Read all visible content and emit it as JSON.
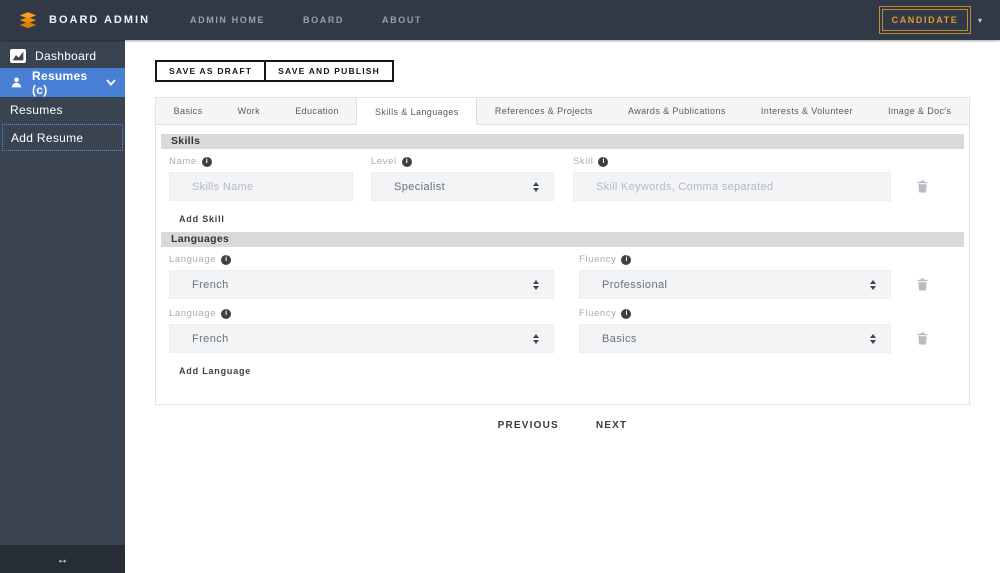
{
  "navbar": {
    "brand": "BOARD ADMIN",
    "links": [
      "ADMIN HOME",
      "BOARD",
      "ABOUT"
    ],
    "candidate_label": "CANDIDATE",
    "caret_icon": "▾"
  },
  "sidebar": {
    "dashboard": "Dashboard",
    "resumes_group": "Resumes (c)",
    "resumes": "Resumes",
    "add_resume": "Add Resume",
    "collapse_icon": "↔"
  },
  "actions": {
    "save_draft": "SAVE AS DRAFT",
    "save_publish": "SAVE AND PUBLISH"
  },
  "tabs": [
    "Basics",
    "Work",
    "Education",
    "Skills & Languages",
    "References & Projects",
    "Awards & Publications",
    "Interests & Volunteer",
    "Image & Doc's"
  ],
  "active_tab": "Skills & Languages",
  "skills": {
    "section_title": "Skills",
    "name_label": "Name",
    "name_placeholder": "Skills Name",
    "level_label": "Level",
    "level_value": "Specialist",
    "skill_label": "Skill",
    "skill_placeholder": "Skill Keywords, Comma separated",
    "add_label": "Add Skill"
  },
  "languages": {
    "section_title": "Languages",
    "rows": [
      {
        "language_label": "Language",
        "language_value": "French",
        "fluency_label": "Fluency",
        "fluency_value": "Professional"
      },
      {
        "language_label": "Language",
        "language_value": "French",
        "fluency_label": "Fluency",
        "fluency_value": "Basics"
      }
    ],
    "add_label": "Add Language"
  },
  "pagination": {
    "previous": "PREVIOUS",
    "next": "NEXT"
  },
  "icons": {
    "info": "i"
  },
  "colors": {
    "accent_blue": "#4a7fd6",
    "accent_orange": "#e09a35",
    "navbar_bg": "#313947",
    "sidebar_bg": "#3a4450"
  }
}
